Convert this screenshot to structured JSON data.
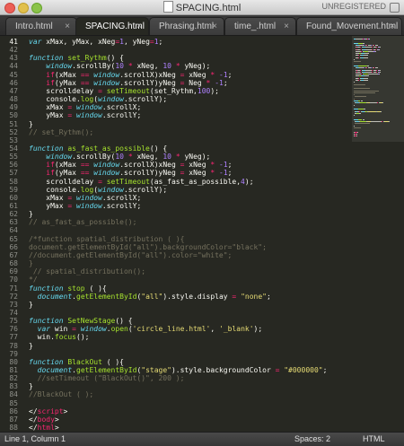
{
  "window": {
    "title": "SPACING.html",
    "license_status": "UNREGISTERED"
  },
  "tabs": [
    {
      "label": "Intro.html",
      "active": false
    },
    {
      "label": "SPACING.html",
      "active": true
    },
    {
      "label": "Phrasing.html",
      "active": false
    },
    {
      "label": "time_.html",
      "active": false
    },
    {
      "label": "Found_Movement.html",
      "active": false
    }
  ],
  "tab_close_glyph": "×",
  "editor": {
    "line_numbers": [
      "41",
      "42",
      "43",
      "44",
      "45",
      "46",
      "47",
      "48",
      "49",
      "50",
      "51",
      "52",
      "53",
      "54",
      "55",
      "56",
      "57",
      "58",
      "59",
      "60",
      "61",
      "62",
      "63",
      "64",
      "65",
      "66",
      "67",
      "68",
      "69",
      "70",
      "71",
      "72",
      "73",
      "74",
      "75",
      "76",
      "77",
      "78",
      "79",
      "80",
      "81",
      "82",
      "83",
      "84",
      "85",
      "86",
      "87",
      "88"
    ],
    "lines": [
      [
        {
          "t": "var ",
          "c": "k"
        },
        {
          "t": "xMax, yMax, xNeg",
          "c": ""
        },
        {
          "t": "=",
          "c": "kw"
        },
        {
          "t": "1",
          "c": "nm"
        },
        {
          "t": ", yNeg",
          "c": ""
        },
        {
          "t": "=",
          "c": "kw"
        },
        {
          "t": "1",
          "c": "nm"
        },
        {
          "t": ";",
          "c": ""
        }
      ],
      [],
      [
        {
          "t": "function ",
          "c": "k"
        },
        {
          "t": "set_Rythm",
          "c": "fn"
        },
        {
          "t": "() {",
          "c": ""
        }
      ],
      [
        {
          "t": "    ",
          "c": ""
        },
        {
          "t": "window",
          "c": "obj"
        },
        {
          "t": ".scrollBy(",
          "c": ""
        },
        {
          "t": "10",
          "c": "nm"
        },
        {
          "t": " ",
          "c": ""
        },
        {
          "t": "*",
          "c": "kw"
        },
        {
          "t": " xNeg, ",
          "c": ""
        },
        {
          "t": "10",
          "c": "nm"
        },
        {
          "t": " ",
          "c": ""
        },
        {
          "t": "*",
          "c": "kw"
        },
        {
          "t": " yNeg);",
          "c": ""
        }
      ],
      [
        {
          "t": "    ",
          "c": ""
        },
        {
          "t": "if",
          "c": "kw"
        },
        {
          "t": "(xMax ",
          "c": ""
        },
        {
          "t": "==",
          "c": "kw"
        },
        {
          "t": " ",
          "c": ""
        },
        {
          "t": "window",
          "c": "obj"
        },
        {
          "t": ".scrollX)xNeg ",
          "c": ""
        },
        {
          "t": "=",
          "c": "kw"
        },
        {
          "t": " xNeg ",
          "c": ""
        },
        {
          "t": "*",
          "c": "kw"
        },
        {
          "t": " ",
          "c": ""
        },
        {
          "t": "-1",
          "c": "nm"
        },
        {
          "t": ";",
          "c": ""
        }
      ],
      [
        {
          "t": "    ",
          "c": ""
        },
        {
          "t": "if",
          "c": "kw"
        },
        {
          "t": "(yMax ",
          "c": ""
        },
        {
          "t": "==",
          "c": "kw"
        },
        {
          "t": " ",
          "c": ""
        },
        {
          "t": "window",
          "c": "obj"
        },
        {
          "t": ".scrollY)yNeg ",
          "c": ""
        },
        {
          "t": "=",
          "c": "kw"
        },
        {
          "t": " Neg ",
          "c": ""
        },
        {
          "t": "*",
          "c": "kw"
        },
        {
          "t": " ",
          "c": ""
        },
        {
          "t": "-1",
          "c": "nm"
        },
        {
          "t": ";",
          "c": ""
        }
      ],
      [
        {
          "t": "    scrolldelay ",
          "c": ""
        },
        {
          "t": "=",
          "c": "kw"
        },
        {
          "t": " ",
          "c": ""
        },
        {
          "t": "setTimeout",
          "c": "fn"
        },
        {
          "t": "(set_Rythm,",
          "c": ""
        },
        {
          "t": "100",
          "c": "nm"
        },
        {
          "t": ");",
          "c": ""
        }
      ],
      [
        {
          "t": "    console.",
          "c": ""
        },
        {
          "t": "log",
          "c": "fn"
        },
        {
          "t": "(",
          "c": ""
        },
        {
          "t": "window",
          "c": "obj"
        },
        {
          "t": ".scrollY);",
          "c": ""
        }
      ],
      [
        {
          "t": "    xMax ",
          "c": ""
        },
        {
          "t": "=",
          "c": "kw"
        },
        {
          "t": " ",
          "c": ""
        },
        {
          "t": "window",
          "c": "obj"
        },
        {
          "t": ".scrollX;",
          "c": ""
        }
      ],
      [
        {
          "t": "    yMax ",
          "c": ""
        },
        {
          "t": "=",
          "c": "kw"
        },
        {
          "t": " ",
          "c": ""
        },
        {
          "t": "window",
          "c": "obj"
        },
        {
          "t": ".scrollY;",
          "c": ""
        }
      ],
      [
        {
          "t": "}",
          "c": ""
        }
      ],
      [
        {
          "t": "// set_Rythm();",
          "c": "cm"
        }
      ],
      [],
      [
        {
          "t": "function ",
          "c": "k"
        },
        {
          "t": "as_fast_as_possible",
          "c": "fn"
        },
        {
          "t": "() {",
          "c": ""
        }
      ],
      [
        {
          "t": "    ",
          "c": ""
        },
        {
          "t": "window",
          "c": "obj"
        },
        {
          "t": ".scrollBy(",
          "c": ""
        },
        {
          "t": "10",
          "c": "nm"
        },
        {
          "t": " ",
          "c": ""
        },
        {
          "t": "*",
          "c": "kw"
        },
        {
          "t": " xNeg, ",
          "c": ""
        },
        {
          "t": "10",
          "c": "nm"
        },
        {
          "t": " ",
          "c": ""
        },
        {
          "t": "*",
          "c": "kw"
        },
        {
          "t": " yNeg);",
          "c": ""
        }
      ],
      [
        {
          "t": "    ",
          "c": ""
        },
        {
          "t": "if",
          "c": "kw"
        },
        {
          "t": "(xMax ",
          "c": ""
        },
        {
          "t": "==",
          "c": "kw"
        },
        {
          "t": " ",
          "c": ""
        },
        {
          "t": "window",
          "c": "obj"
        },
        {
          "t": ".scrollX)xNeg ",
          "c": ""
        },
        {
          "t": "=",
          "c": "kw"
        },
        {
          "t": " xNeg ",
          "c": ""
        },
        {
          "t": "*",
          "c": "kw"
        },
        {
          "t": " ",
          "c": ""
        },
        {
          "t": "-1",
          "c": "nm"
        },
        {
          "t": ";",
          "c": ""
        }
      ],
      [
        {
          "t": "    ",
          "c": ""
        },
        {
          "t": "if",
          "c": "kw"
        },
        {
          "t": "(yMax ",
          "c": ""
        },
        {
          "t": "==",
          "c": "kw"
        },
        {
          "t": " ",
          "c": ""
        },
        {
          "t": "window",
          "c": "obj"
        },
        {
          "t": ".scrollY)yNeg ",
          "c": ""
        },
        {
          "t": "=",
          "c": "kw"
        },
        {
          "t": " xNeg ",
          "c": ""
        },
        {
          "t": "*",
          "c": "kw"
        },
        {
          "t": " ",
          "c": ""
        },
        {
          "t": "-1",
          "c": "nm"
        },
        {
          "t": ";",
          "c": ""
        }
      ],
      [
        {
          "t": "    scrolldelay ",
          "c": ""
        },
        {
          "t": "=",
          "c": "kw"
        },
        {
          "t": " ",
          "c": ""
        },
        {
          "t": "setTimeout",
          "c": "fn"
        },
        {
          "t": "(as_fast_as_possible,",
          "c": ""
        },
        {
          "t": "4",
          "c": "nm"
        },
        {
          "t": ");",
          "c": ""
        }
      ],
      [
        {
          "t": "    console.",
          "c": ""
        },
        {
          "t": "log",
          "c": "fn"
        },
        {
          "t": "(",
          "c": ""
        },
        {
          "t": "window",
          "c": "obj"
        },
        {
          "t": ".scrollY);",
          "c": ""
        }
      ],
      [
        {
          "t": "    xMax ",
          "c": ""
        },
        {
          "t": "=",
          "c": "kw"
        },
        {
          "t": " ",
          "c": ""
        },
        {
          "t": "window",
          "c": "obj"
        },
        {
          "t": ".scrollX;",
          "c": ""
        }
      ],
      [
        {
          "t": "    yMax ",
          "c": ""
        },
        {
          "t": "=",
          "c": "kw"
        },
        {
          "t": " ",
          "c": ""
        },
        {
          "t": "window",
          "c": "obj"
        },
        {
          "t": ".scrollY;",
          "c": ""
        }
      ],
      [
        {
          "t": "}",
          "c": ""
        }
      ],
      [
        {
          "t": "// as_fast_as_possible();",
          "c": "cm"
        }
      ],
      [],
      [
        {
          "t": "/*function spatial_distribution ( ){",
          "c": "cm"
        }
      ],
      [
        {
          "t": "document.getElementById(\"all\").backgroundColor=\"black\";",
          "c": "cm"
        }
      ],
      [
        {
          "t": "//document.getElementById(\"all\").color=\"white\";",
          "c": "cm"
        }
      ],
      [
        {
          "t": "}",
          "c": "cm"
        }
      ],
      [
        {
          "t": " // spatial_distribution();",
          "c": "cm"
        }
      ],
      [
        {
          "t": "*/",
          "c": "cm"
        }
      ],
      [
        {
          "t": "function ",
          "c": "k"
        },
        {
          "t": "stop",
          "c": "fn"
        },
        {
          "t": " ( ){",
          "c": ""
        }
      ],
      [
        {
          "t": "  ",
          "c": ""
        },
        {
          "t": "document",
          "c": "obj"
        },
        {
          "t": ".",
          "c": ""
        },
        {
          "t": "getElementById",
          "c": "fn"
        },
        {
          "t": "(",
          "c": ""
        },
        {
          "t": "\"all\"",
          "c": "st"
        },
        {
          "t": ").style.display ",
          "c": ""
        },
        {
          "t": "=",
          "c": "kw"
        },
        {
          "t": " ",
          "c": ""
        },
        {
          "t": "\"none\"",
          "c": "st"
        },
        {
          "t": ";",
          "c": ""
        }
      ],
      [
        {
          "t": "}",
          "c": ""
        }
      ],
      [],
      [
        {
          "t": "function ",
          "c": "k"
        },
        {
          "t": "SetNewStage",
          "c": "fn"
        },
        {
          "t": "() {",
          "c": ""
        }
      ],
      [
        {
          "t": "  ",
          "c": ""
        },
        {
          "t": "var ",
          "c": "k"
        },
        {
          "t": "win ",
          "c": ""
        },
        {
          "t": "=",
          "c": "kw"
        },
        {
          "t": " ",
          "c": ""
        },
        {
          "t": "window",
          "c": "obj"
        },
        {
          "t": ".",
          "c": ""
        },
        {
          "t": "open",
          "c": "fn"
        },
        {
          "t": "(",
          "c": ""
        },
        {
          "t": "'circle_line.html'",
          "c": "st"
        },
        {
          "t": ", ",
          "c": ""
        },
        {
          "t": "'_blank'",
          "c": "st"
        },
        {
          "t": ");",
          "c": ""
        }
      ],
      [
        {
          "t": "  win.",
          "c": ""
        },
        {
          "t": "focus",
          "c": "fn"
        },
        {
          "t": "();",
          "c": ""
        }
      ],
      [
        {
          "t": "}",
          "c": ""
        }
      ],
      [],
      [
        {
          "t": "function ",
          "c": "k"
        },
        {
          "t": "BlackOut",
          "c": "fn"
        },
        {
          "t": " ( ){",
          "c": ""
        }
      ],
      [
        {
          "t": "  ",
          "c": ""
        },
        {
          "t": "document",
          "c": "obj"
        },
        {
          "t": ".",
          "c": ""
        },
        {
          "t": "getElementById",
          "c": "fn"
        },
        {
          "t": "(",
          "c": ""
        },
        {
          "t": "\"stage\"",
          "c": "st"
        },
        {
          "t": ").style.backgroundColor ",
          "c": ""
        },
        {
          "t": "=",
          "c": "kw"
        },
        {
          "t": " ",
          "c": ""
        },
        {
          "t": "\"#000000\"",
          "c": "st"
        },
        {
          "t": ";",
          "c": ""
        }
      ],
      [
        {
          "t": "  //setTimeout (\"BlackOut()\", 200 );",
          "c": "cm"
        }
      ],
      [
        {
          "t": "}",
          "c": ""
        }
      ],
      [
        {
          "t": "//BlackOut ( );",
          "c": "cm"
        }
      ],
      [],
      [
        {
          "t": "</",
          "c": ""
        },
        {
          "t": "script",
          "c": "kw"
        },
        {
          "t": ">",
          "c": ""
        }
      ],
      [
        {
          "t": "</",
          "c": ""
        },
        {
          "t": "body",
          "c": "kw"
        },
        {
          "t": ">",
          "c": ""
        }
      ],
      [
        {
          "t": "</",
          "c": ""
        },
        {
          "t": "html",
          "c": "kw"
        },
        {
          "t": ">",
          "c": ""
        }
      ]
    ]
  },
  "statusbar": {
    "position": "Line 1, Column 1",
    "indentation": "Spaces: 2",
    "syntax": "HTML"
  },
  "colors": {
    "editor_bg": "#272822",
    "keyword": "#f92672",
    "storage": "#66d9ef",
    "function": "#a6e22e",
    "number": "#ae81ff",
    "string": "#e6db74",
    "comment": "#75715e"
  }
}
